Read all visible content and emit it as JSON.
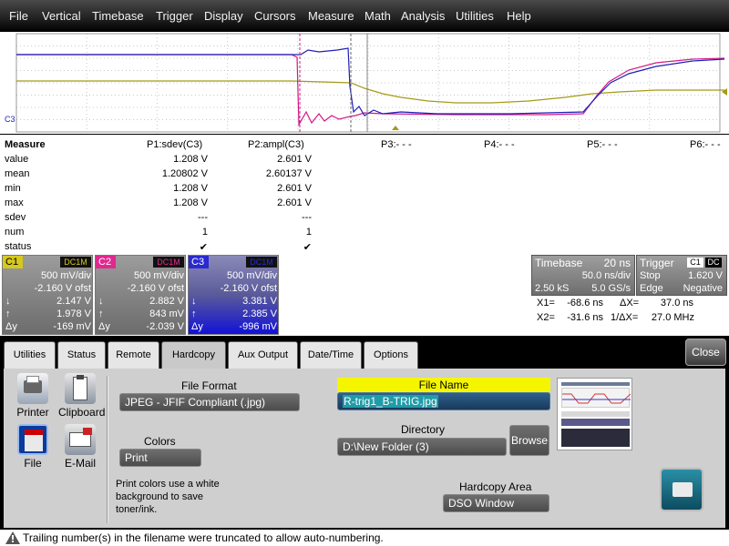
{
  "menu": [
    "File",
    "Vertical",
    "Timebase",
    "Trigger",
    "Display",
    "Cursors",
    "Measure",
    "Math",
    "Analysis",
    "Utilities",
    "Help"
  ],
  "scope": {
    "grid_color": "#c8c8c8",
    "trace_colors": {
      "c1": "#a59a18",
      "c2": "#d21b87",
      "c3": "#1f1fb8"
    },
    "c3_marker": "C3"
  },
  "measure": {
    "title": "Measure",
    "row_labels": [
      "value",
      "mean",
      "min",
      "max",
      "sdev",
      "num",
      "status"
    ],
    "params": [
      {
        "header": "P1:sdev(C3)",
        "values": [
          "1.208 V",
          "1.20802 V",
          "1.208 V",
          "1.208 V",
          "---",
          "1",
          "✔"
        ]
      },
      {
        "header": "P2:ampl(C3)",
        "values": [
          "2.601 V",
          "2.60137 V",
          "2.601 V",
          "2.601 V",
          "---",
          "1",
          "✔"
        ]
      }
    ],
    "empty_params": [
      "P3:- - -",
      "P4:- - -",
      "P5:- - -",
      "P6:- - -"
    ]
  },
  "channels": [
    {
      "label": "C1",
      "coupling": "DC1M",
      "vdiv": "500 mV/div",
      "offset": "-2.160 V ofst",
      "down": "2.147 V",
      "up": "1.978 V",
      "dy": "-169 mV",
      "color": "#d6c81c"
    },
    {
      "label": "C2",
      "coupling": "DC1M",
      "vdiv": "500 mV/div",
      "offset": "-2.160 V ofst",
      "down": "2.882 V",
      "up": "843 mV",
      "dy": "-2.039 V",
      "color": "#e0288e"
    },
    {
      "label": "C3",
      "coupling": "DC1M",
      "vdiv": "500 mV/div",
      "offset": "-2.160 V ofst",
      "down": "3.381 V",
      "up": "2.385 V",
      "dy": "-996 mV",
      "color": "#2a2ad0"
    }
  ],
  "timebase": {
    "label": "Timebase",
    "value": "20 ns",
    "sdiv": "50.0 ns/div",
    "samples": "2.50 kS",
    "rate": "5.0 GS/s"
  },
  "trigger": {
    "label": "Trigger",
    "source": "C1",
    "coupling": "DC",
    "mode": "Stop",
    "level": "1.620 V",
    "type": "Edge",
    "slope": "Negative"
  },
  "cursors": {
    "x1_label": "X1=",
    "x1": "-68.6 ns",
    "dx_label": "ΔX=",
    "dx": "37.0 ns",
    "x2_label": "X2=",
    "x2": "-31.6 ns",
    "inv_label": "1/ΔX=",
    "inv": "27.0 MHz"
  },
  "dialog": {
    "tabs": [
      "Utilities",
      "Status",
      "Remote",
      "Hardcopy",
      "Aux Output",
      "Date/Time",
      "Options"
    ],
    "active_tab": "Hardcopy",
    "close_label": "Close",
    "devices": [
      "Printer",
      "Clipboard",
      "File",
      "E-Mail"
    ],
    "file_format_label": "File Format",
    "file_format": "JPEG - JFIF Compliant (.jpg)",
    "colors_label": "Colors",
    "colors": "Print",
    "colors_note": "Print colors use a white background to save toner/ink.",
    "file_name_label": "File Name",
    "file_name": "R-trig1_B-TRIG.jpg",
    "directory_label": "Directory",
    "directory": "D:\\New Folder (3)",
    "browse_label": "Browse",
    "hardcopy_area_label": "Hardcopy Area",
    "hardcopy_area": "DSO Window"
  },
  "status_message": "Trailing number(s) in the filename were truncated to allow auto-numbering."
}
